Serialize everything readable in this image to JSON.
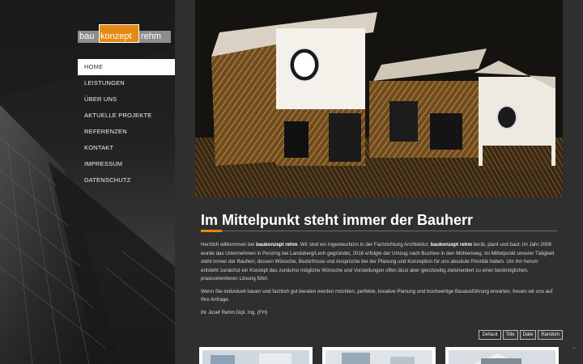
{
  "logo": {
    "part1": "bau",
    "part2": "konzept",
    "part3": "rehm"
  },
  "nav": {
    "items": [
      {
        "label": "HOME"
      },
      {
        "label": "LEISTUNGEN"
      },
      {
        "label": "ÜBER UNS"
      },
      {
        "label": "AKTUELLE PROJEKTE"
      },
      {
        "label": "REFERENZEN"
      },
      {
        "label": "KONTAKT"
      },
      {
        "label": "IMPRESSUM"
      },
      {
        "label": "DATENSCHUTZ"
      }
    ],
    "active_index": 0
  },
  "main": {
    "headline": "Im Mittelpunkt steht immer der Bauherr",
    "para1": {
      "t1": "Herzlich willkommen bei ",
      "b1": "baukonzept rehm",
      "t2": ". Wir sind ein Ingenieurbüro in der Fachrichtung Architektur. ",
      "b2": "baukonzept rehm",
      "t3": " berät, plant und baut. Im Jahr 2008 wurde das Unternehmen in Penzing bei Landsberg/Lech gegründet, 2018 erfolgte der Umzug nach Buchloe in den Mühlenweg. Im Mittelpunkt unserer Tätigkeit steht immer der Bauherr, dessen Wünsche, Bedürfnisse und Ansprüche bei der Planung und Konzeption für uns absolute Priorität haben. Um Ihn herum entsteht zunächst ein Konzept das zunächst mögliche Wünsche und Vorstellungen offen lässt aber gleichzeitig zielorientiert zu einer bestmöglichen, praxisorientieren Lösung führt."
    },
    "para2": "Wenn Sie individuell bauen und fachlich gut beraten werden möchten, perfekte, kreative Planung und hochwertige Bauausführung erwarten, freuen wir uns auf Ihre Anfrage.",
    "signature": "Ihr Josef Rehm Dipl. Ing. (FH)"
  },
  "sort": {
    "default": "Default",
    "title": "Title",
    "date": "Date",
    "random": "Random"
  },
  "colors": {
    "accent": "#e58a12",
    "sidebar_bg": "#222222",
    "main_bg": "#2f2f2f"
  },
  "icons": {
    "scroll_top": "chevron-up-icon"
  }
}
